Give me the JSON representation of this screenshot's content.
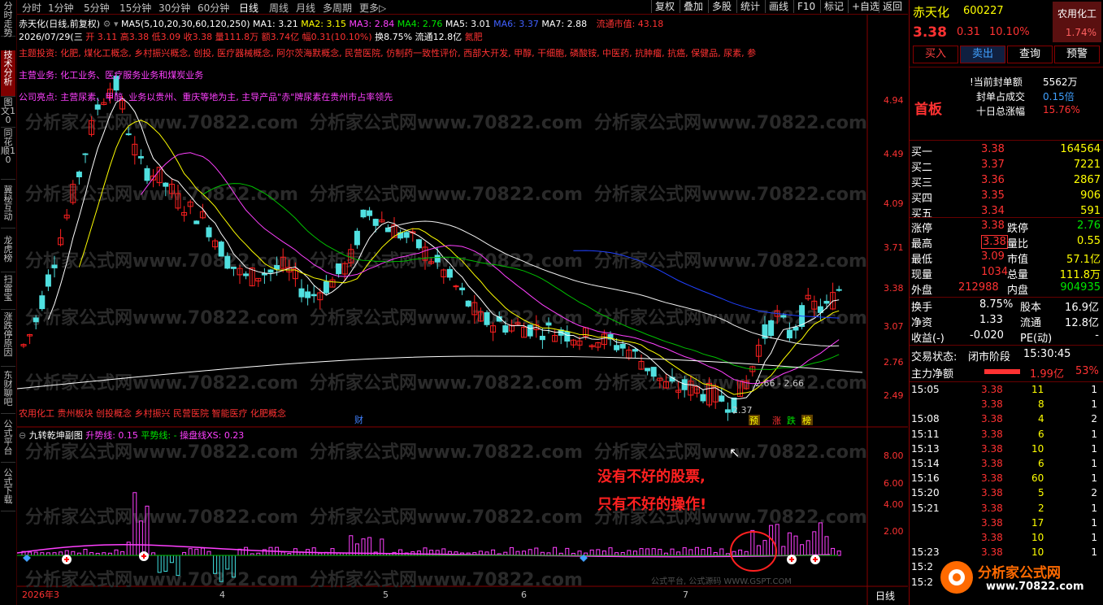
{
  "topbar": {
    "periods": [
      "分时",
      "1分钟",
      "5分钟",
      "15分钟",
      "30分钟",
      "60分钟",
      "日线",
      "周线",
      "月线",
      "多周期",
      "更多▷"
    ],
    "selected_period": "日线",
    "tools": [
      "复权",
      "叠加",
      "多股",
      "统计",
      "画线",
      "F10",
      "标记",
      "+自选",
      "返回"
    ]
  },
  "leftnav": [
    "分时走势",
    "技术分析",
    "图文10",
    "同花顺10",
    "冀秘互动",
    "龙虎榜",
    "扫雷宝",
    "涨跌停原因",
    "东财聊吧",
    "公式平台",
    "公式下载"
  ],
  "header": {
    "stock_name": "赤天化",
    "chart_mode": "(日线,前复权)",
    "ma_label": "MA5(5,10,20,30,60,120,250)",
    "ma1": "MA1: 3.21",
    "ma2": "MA2: 3.15",
    "ma3": "MA3: 2.84",
    "ma4": "MA4: 2.76",
    "ma5": "MA5: 3.01",
    "ma6": "MA6: 3.37",
    "ma7": "MA7: 2.88",
    "float_cap": "流通市值: 43.18",
    "date": "2026/07/29(三",
    "ohlc": "开 3.11 高3.38 低3.09 收3.38 量111.8万 额3.74亿 幅0.31(10.10%)",
    "turnover": "换8.75% 流通12.8亿",
    "concept": "氮肥"
  },
  "notes": {
    "themes": "主题投资: 化肥, 煤化工概念, 乡村振兴概念, 创投, 医疗器械概念, 阿尔茨海默概念, 民营医院, 仿制药一致性评价, 西部大开发, 甲醇, 干细胞, 磷酸铵, 中医药, 抗肿瘤, 抗癌, 保健品, 尿素, 参",
    "business": "主营业务: 化工业务、医疗服务业务和煤炭业务",
    "highlights": "公司亮点: 主营尿素、甲醇, 业务以贵州、重庆等地为主, 主导产品\"赤\"牌尿素在贵州市占率领先",
    "sectors": "农用化工 贵州板块 创投概念 乡村振兴 民营医院 智能医疗 化肥概念"
  },
  "price_axis": [
    "4.94",
    "4.49",
    "4.09",
    "3.71",
    "3.38",
    "3.07",
    "2.76",
    "2.49"
  ],
  "price_annotations": {
    "cai": "财",
    "low": "2.37",
    "gap": "2.66 - 2.66",
    "tags": [
      "预",
      "涨",
      "跌",
      "榜"
    ]
  },
  "indicator": {
    "title": "九转乾坤副图",
    "l1": "升势线: 0.15",
    "l2": "平势线: -",
    "l3": "操盘线XS: 0.23",
    "axis": [
      "8.00",
      "6.00",
      "4.00",
      "2.00"
    ],
    "slogan1": "没有不好的股票,",
    "slogan2": "只有不好的操作!"
  },
  "dates": [
    "2026年3",
    "4",
    "5",
    "6",
    "7"
  ],
  "bottom_right": "日线",
  "watermarks": {
    "site": "分析家公式网www.70822.com",
    "gspt": "公式平台, 公式源码 WWW.GSPT.COM",
    "logo": "分析家公式网",
    "logo_url": "www.70822.com"
  },
  "panel": {
    "name": "赤天化",
    "code": "600227",
    "industry": "农用化工",
    "industry_pct": "1.74%",
    "price": "3.38",
    "change": "0.31",
    "pct": "10.10%",
    "buttons": [
      "买入",
      "卖出",
      "查询",
      "预警"
    ],
    "board": "首板",
    "seal_amount_label": "!当前封单额",
    "seal_amount": "5562万",
    "seal_ratio_label": "封单占成交",
    "seal_ratio": "0.15倍",
    "ten_day_label": "十日总涨幅",
    "ten_day": "15.76%",
    "bids": [
      {
        "label": "买一",
        "price": "3.38",
        "vol": "164564"
      },
      {
        "label": "买二",
        "price": "3.37",
        "vol": "7221"
      },
      {
        "label": "买三",
        "price": "3.36",
        "vol": "2867"
      },
      {
        "label": "买四",
        "price": "3.35",
        "vol": "906"
      },
      {
        "label": "买五",
        "price": "3.34",
        "vol": "591"
      }
    ],
    "stats": [
      [
        "涨停",
        "3.38",
        "跌停",
        "2.76"
      ],
      [
        "最高",
        "3.38",
        "量比",
        "0.55"
      ],
      [
        "最低",
        "3.09",
        "市值",
        "57.1亿"
      ],
      [
        "现量",
        "1034",
        "总量",
        "111.8万"
      ],
      [
        "外盘",
        "212988",
        "内盘",
        "904935"
      ]
    ],
    "stats2": [
      [
        "换手",
        "8.75%",
        "股本",
        "16.9亿"
      ],
      [
        "净资",
        "1.33",
        "流通",
        "12.8亿"
      ],
      [
        "收益(-)",
        "-0.020",
        "PE(动)",
        "-"
      ]
    ],
    "trade_state_label": "交易状态:",
    "trade_state": "闭市阶段",
    "trade_time": "15:30:45",
    "net_flow_label": "主力净额",
    "net_flow": "1.99亿",
    "net_pct": "53%",
    "ticks": [
      [
        "15:05",
        "3.38",
        "11",
        "1"
      ],
      [
        "",
        "3.38",
        "8",
        "1"
      ],
      [
        "15:08",
        "3.38",
        "4",
        "2"
      ],
      [
        "15:11",
        "3.38",
        "6",
        "1"
      ],
      [
        "15:13",
        "3.38",
        "10",
        "1"
      ],
      [
        "15:14",
        "3.38",
        "6",
        "1"
      ],
      [
        "15:16",
        "3.38",
        "60",
        "1"
      ],
      [
        "15:20",
        "3.38",
        "5",
        "2"
      ],
      [
        "15:21",
        "3.38",
        "2",
        "1"
      ],
      [
        "",
        "3.38",
        "17",
        "1"
      ],
      [
        "",
        "3.38",
        "10",
        "1"
      ],
      [
        "15:23",
        "3.38",
        "10",
        "1"
      ],
      [
        "15:2",
        "",
        "",
        ""
      ],
      [
        "15:2",
        "",
        "",
        ""
      ]
    ]
  }
}
